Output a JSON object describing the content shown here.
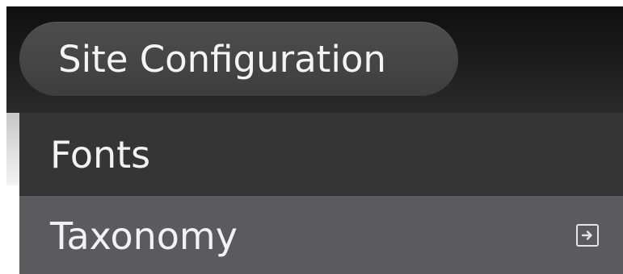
{
  "header": {
    "title": "Site Configuration"
  },
  "menu": {
    "items": [
      {
        "label": "Fonts",
        "icon": null
      },
      {
        "label": "Taxonomy",
        "icon": "open-arrow-icon"
      }
    ]
  },
  "colors": {
    "header_bg": "#1b1b1b",
    "pill_bg": "#454545",
    "item_bg": "#353535",
    "item_selected_bg": "#5b5b5d",
    "text": "#f2f2f2"
  }
}
